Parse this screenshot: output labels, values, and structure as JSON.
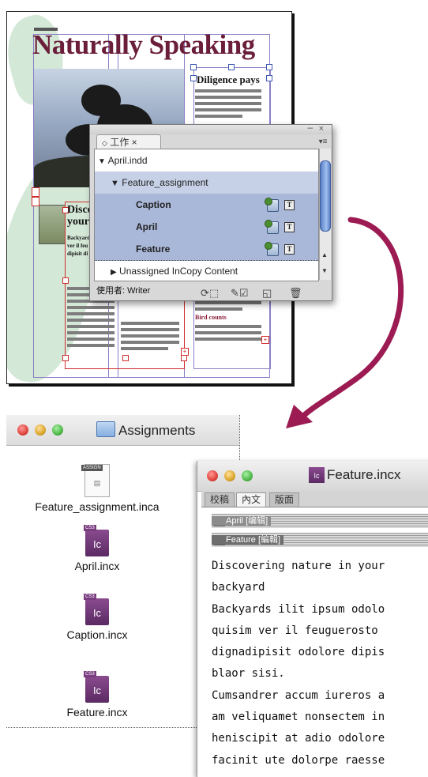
{
  "layout_page": {
    "masthead": "Naturally Speaking",
    "sidebar_headline": "Diligence pays",
    "sidebar_subhead": "Bird counts",
    "feature_headline": "Discov your",
    "feature_body_snippet": "Backyard ver il feu dipisit di"
  },
  "assignments_panel": {
    "tab_label": "工作",
    "tab_close": "×",
    "document_row": "April.indd",
    "assignment_row": "Feature_assignment",
    "stories": [
      {
        "label": "Caption"
      },
      {
        "label": "April"
      },
      {
        "label": "Feature"
      }
    ],
    "unassigned_row": "Unassigned InCopy Content",
    "user_label": "使用者: Writer"
  },
  "assignments_window": {
    "title": "Assignments",
    "files": [
      {
        "name": "Feature_assignment.inca",
        "icon": "inca-file-icon"
      },
      {
        "name": "April.incx",
        "icon": "incx-file-icon"
      },
      {
        "name": "Caption.incx",
        "icon": "incx-file-icon"
      },
      {
        "name": "Feature.incx",
        "icon": "incx-file-icon"
      }
    ]
  },
  "feature_window": {
    "title": "Feature.incx",
    "tabs": [
      "校稿",
      "內文",
      "版面"
    ],
    "active_tab": "內文",
    "story_bars": [
      "April [编辑]",
      "Feature [編輯]"
    ],
    "text_lines": [
      "Discovering nature in your",
      "backyard",
      "Backyards ilit ipsum odolo",
      "quisim ver il feuguerosto",
      "dignadipisit odolore dipis",
      "blaor sisi.",
      "Cumsandrer accum iureros a",
      "am veliquamet nonsectem in",
      "heniscipit at adio odolore",
      "facinit ute dolorpe raesse"
    ]
  },
  "colors": {
    "masthead": "#6b1e3a",
    "arrow": "#9b1b52",
    "selection": "#a9b7d8",
    "traffic_red": "#e0443e",
    "traffic_yellow": "#dba52c",
    "traffic_green": "#4fb848"
  }
}
